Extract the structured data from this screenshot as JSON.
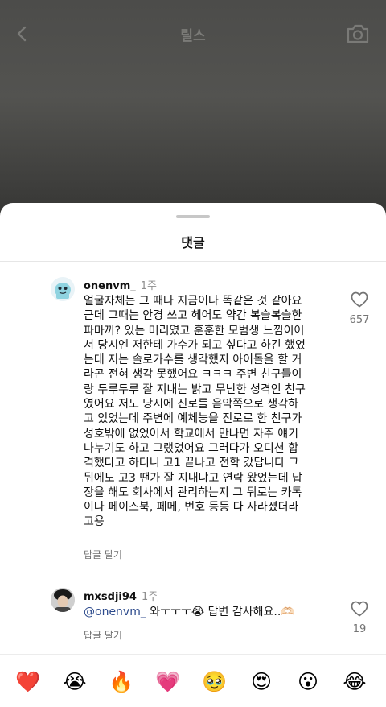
{
  "header": {
    "title": "릴스",
    "back_icon": "chevron-left-icon",
    "camera_icon": "camera-icon"
  },
  "sheet": {
    "title": "댓글"
  },
  "comments": [
    {
      "username": "onenvm_",
      "time": "1주",
      "text": "얼굴자체는 그 때나 지금이나 똑같은 것 같아요\n근데 그때는 안경 쓰고 헤어도 약간 복슬복슬한\n파마끼? 있는 머리였고 훈훈한 모범생 느낌이어\n서 당시엔 저한테 가수가 되고 싶다고 하긴 했었\n는데 저는 솔로가수를 생각했지 아이돌을 할 거\n라곤 전혀 생각 못했어요 ㅋㅋㅋ 주변 친구들이\n랑 두루두루 잘 지내는 밝고 무난한 성격인 친구\n였어요 저도 당시에 진로를 음악쪽으로 생각하\n고 있었는데 주변에 예체능을 진로로 한 친구가\n성호밖에 없었어서 학교에서 만나면 자주 얘기\n나누기도 하고 그랬었어요 그러다가 오디션 합\n격했다고 하더니 고1 끝나고 전학 갔답니다 그\n뒤에도 고3 땐가 잘 지내냐고 연락 왔었는데 답\n장을 해도 회사에서 관리하는지 그 뒤로는 카톡\n이나 페이스북, 페메, 번호 등등 다 사라졌더라\n고용",
      "reply_label": "답글 달기",
      "likes": "657"
    },
    {
      "username": "mxsdji94",
      "time": "1주",
      "mention": "@onenvm_",
      "text": " 와ㅜㅜㅜ😭 답변 감사해요..🫶🏻",
      "reply_label": "답글 달기",
      "likes": "19"
    }
  ],
  "emoji_bar": [
    "❤️",
    "😭",
    "🔥",
    "💗",
    "🥹",
    "😍",
    "😮",
    "😂"
  ],
  "colors": {
    "sheet_bg": "#ffffff",
    "text": "#111111",
    "secondary": "#737373",
    "mention": "#2c4a8c"
  }
}
